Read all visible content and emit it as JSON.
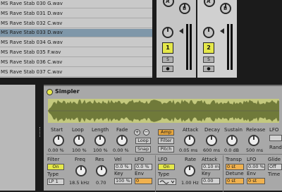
{
  "browser": {
    "files": [
      "MS Rave Stab 030 G.wav",
      "MS Rave Stab 031 D.wav",
      "MS Rave Stab 032 C.wav",
      "MS Rave Stab 033 D.wav",
      "MS Rave Stab 034 G.wav",
      "MS Rave Stab 035 F.wav",
      "MS Rave Stab 036 C.wav",
      "MS Rave Stab 037 C.wav"
    ],
    "selected_index": 3
  },
  "mixer": {
    "tracks": [
      {
        "number": "1",
        "send_a": "A",
        "send_b": "B",
        "solo": "S",
        "record": "●"
      },
      {
        "number": "2",
        "send_a": "A",
        "send_b": "B",
        "solo": "S",
        "record": "●"
      }
    ]
  },
  "simpler": {
    "title": "Simpler",
    "controls": {
      "start": {
        "label": "Start",
        "value": "0.00 %"
      },
      "loop": {
        "label": "Loop",
        "value": "100 %"
      },
      "length": {
        "label": "Length",
        "value": "100 %"
      },
      "fade": {
        "label": "Fade",
        "value": "0.00 %"
      },
      "plus": "+",
      "minus": "−",
      "loop_button": "Loop",
      "snap_button": "Snap",
      "amp_button": "Amp",
      "filter_button": "Filter",
      "pitch_button": "Pitch",
      "attack": {
        "label": "Attack",
        "value": "0.05 ms"
      },
      "decay": {
        "label": "Decay",
        "value": "600 ms"
      },
      "sustain": {
        "label": "Sustain",
        "value": "0.0 dB"
      },
      "release": {
        "label": "Release",
        "value": "500 ms"
      },
      "lfo_top": "LFO",
      "rand_top": "Rando"
    },
    "bottom": {
      "filter_label": "Filter",
      "filter_on": "On",
      "type_label": "Type",
      "type_value": "LP 1",
      "freq_label": "Freq",
      "freq_value": "18.5 kHz",
      "res_label": "Res",
      "res_value": "0.70",
      "vel_label": "Vel",
      "vel_value": "0.0 %",
      "key_label": "Key",
      "key_value": "100 %",
      "lfo_label": "LFO",
      "lfo_value": "0.0 %",
      "env_label": "Env",
      "env_value": "0",
      "lfo2_label": "LFO",
      "lfo2_on": "On",
      "type2_label": "Type",
      "rate_label": "Rate",
      "rate_value": "1.00 Hz",
      "attack2_label": "Attack",
      "attack2_value": "0.10 ms",
      "key2_label": "Key",
      "key2_value": "0.00",
      "transp_label": "Transp",
      "transp_value": "0 st",
      "detune_label": "Detune",
      "detune_value": "0 st",
      "lfo3_label": "LFO",
      "lfo3_value": "0.00 %",
      "env2_label": "Env",
      "env2_value": "0 st",
      "glide_label": "Glide",
      "glide_value": "Off",
      "time_label": "Time"
    }
  }
}
